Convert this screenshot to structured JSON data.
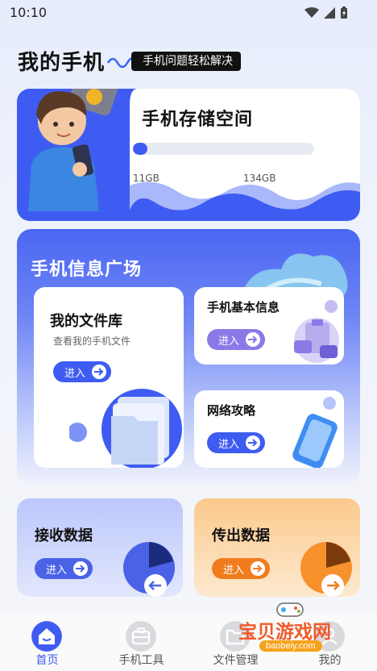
{
  "status": {
    "time": "10:10"
  },
  "header": {
    "title": "我的手机",
    "tag": "手机问题轻松解决"
  },
  "storage": {
    "title": "手机存储空间",
    "used_label": "11GB",
    "total_label": "134GB",
    "progress": 0.08,
    "accent": "#3f5cf2"
  },
  "plaza": {
    "title": "手机信息广场",
    "files": {
      "title": "我的文件库",
      "subtitle": "查看我的手机文件",
      "button": "进入"
    },
    "basic": {
      "title": "手机基本信息",
      "button": "进入"
    },
    "network": {
      "title": "网络攻略",
      "button": "进入"
    }
  },
  "receive": {
    "title": "接收数据",
    "button": "进入"
  },
  "send": {
    "title": "传出数据",
    "button": "进入"
  },
  "nav": {
    "items": [
      {
        "label": "首页",
        "icon": "home-icon",
        "active": true
      },
      {
        "label": "手机工具",
        "icon": "toolbox-icon",
        "active": false
      },
      {
        "label": "文件管理",
        "icon": "folder-icon",
        "active": false
      },
      {
        "label": "我的",
        "icon": "profile-icon",
        "active": false
      }
    ]
  },
  "watermark": {
    "text": "宝贝游戏网",
    "url": "baobeiy.com"
  }
}
